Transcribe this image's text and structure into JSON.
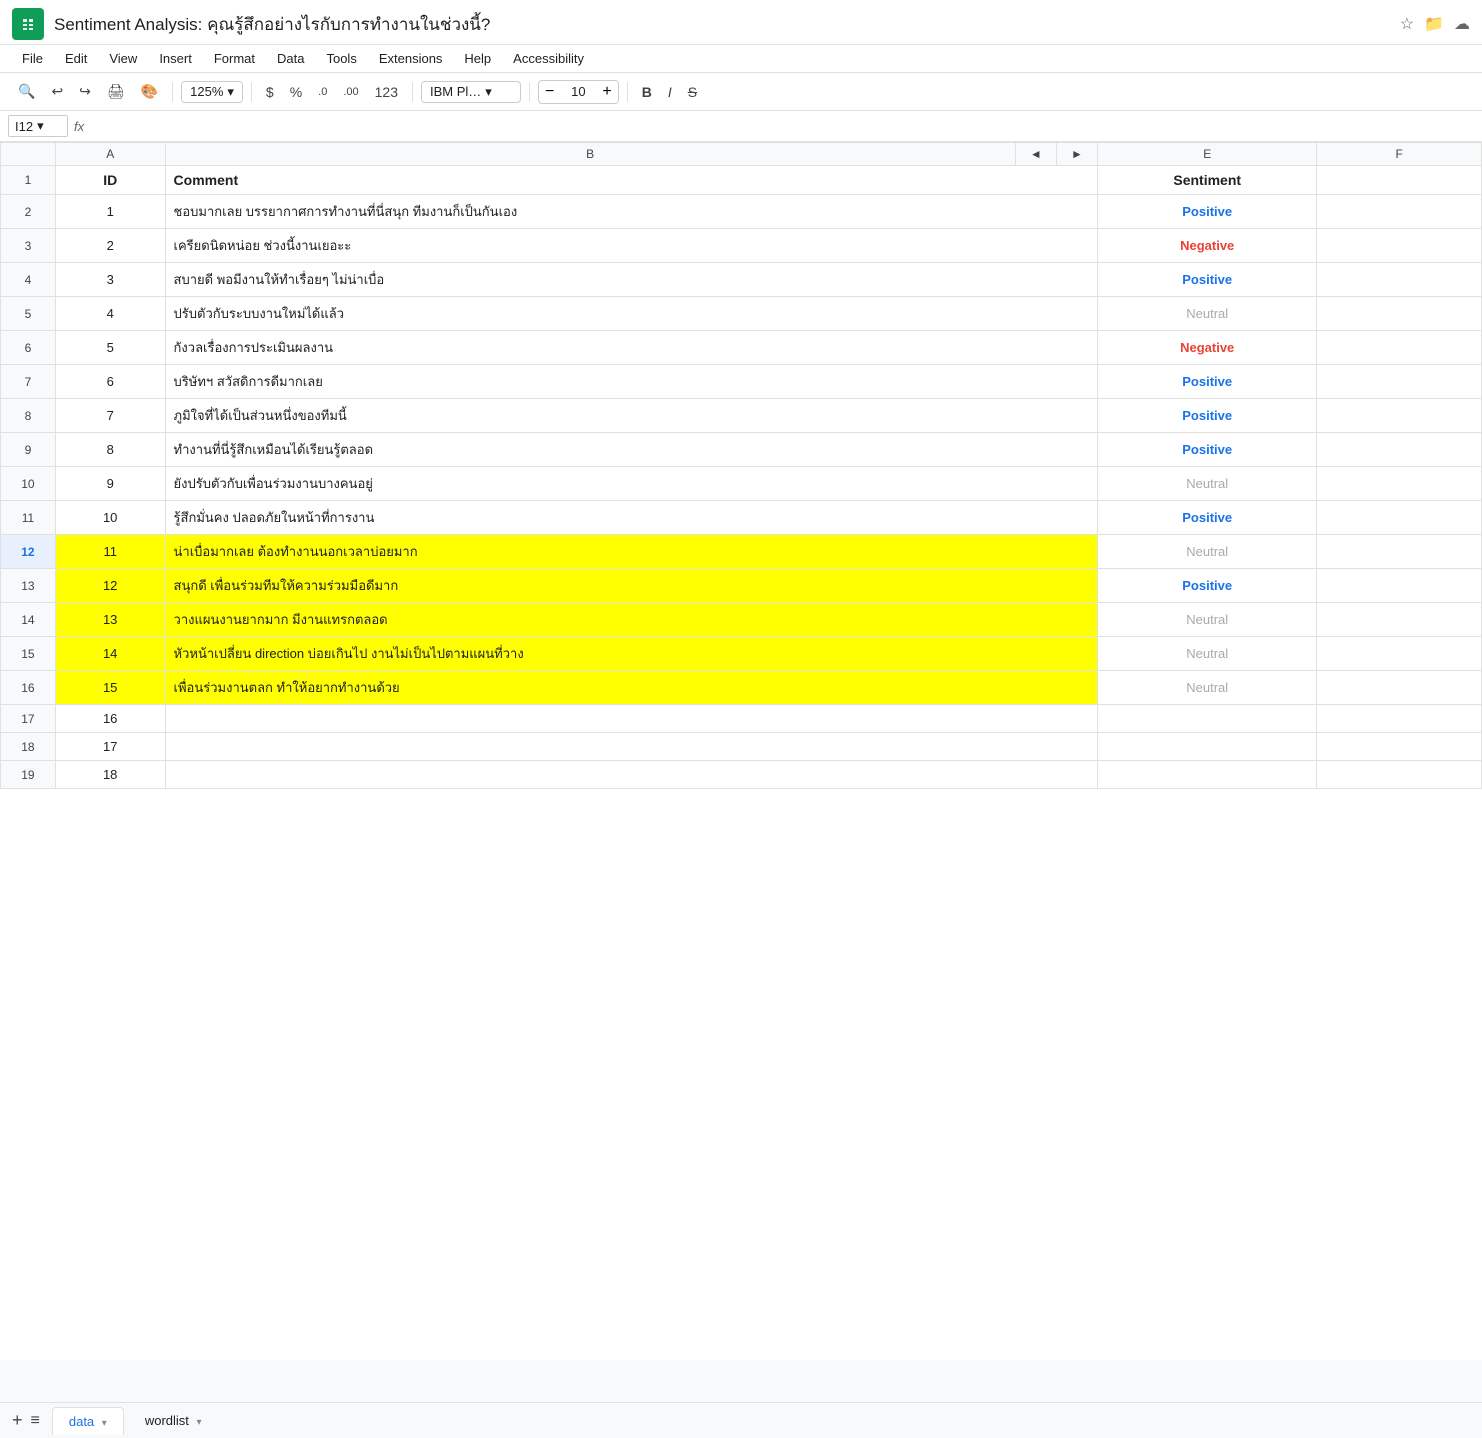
{
  "window": {
    "title": "Sentiment Analysis: คุณรู้สึกอย่างไรกับการทำงานในช่วงนี้?"
  },
  "menu": {
    "items": [
      "File",
      "Edit",
      "View",
      "Insert",
      "Format",
      "Data",
      "Tools",
      "Extensions",
      "Help",
      "Accessibility"
    ]
  },
  "toolbar": {
    "zoom": "125%",
    "font": "IBM Pl…",
    "font_size": "10",
    "currency_symbol": "$",
    "percent_symbol": "%",
    "decimal_decrease": ".0",
    "decimal_increase": ".00",
    "number_format": "123"
  },
  "formula_bar": {
    "cell_ref": "I12",
    "fx_label": "fx"
  },
  "columns": {
    "num": "",
    "a": "A",
    "b": "B",
    "arrow_left": "◄",
    "arrow_right": "►",
    "e": "E",
    "f": "F"
  },
  "rows": [
    {
      "row": "1",
      "id": "ID",
      "comment": "Comment",
      "sentiment": "Sentiment",
      "is_header": true,
      "highlighted": false,
      "active": false
    },
    {
      "row": "2",
      "id": "1",
      "comment": "ชอบมากเลย บรรยากาศการทำงานที่นี่สนุก ทีมงานก็เป็นกันเอง",
      "sentiment": "Positive",
      "sentiment_type": "positive",
      "highlighted": false,
      "active": false
    },
    {
      "row": "3",
      "id": "2",
      "comment": "เครียดนิดหน่อย ช่วงนี้งานเยอะะ",
      "sentiment": "Negative",
      "sentiment_type": "negative",
      "highlighted": false,
      "active": false
    },
    {
      "row": "4",
      "id": "3",
      "comment": "สบายดี พอมีงานให้ทำเรื่อยๆ ไม่น่าเบื่อ",
      "sentiment": "Positive",
      "sentiment_type": "positive",
      "highlighted": false,
      "active": false
    },
    {
      "row": "5",
      "id": "4",
      "comment": "ปรับตัวกับระบบงานใหม่ได้แล้ว",
      "sentiment": "Neutral",
      "sentiment_type": "neutral",
      "highlighted": false,
      "active": false
    },
    {
      "row": "6",
      "id": "5",
      "comment": "กังวลเรื่องการประเมินผลงาน",
      "sentiment": "Negative",
      "sentiment_type": "negative",
      "highlighted": false,
      "active": false
    },
    {
      "row": "7",
      "id": "6",
      "comment": "บริษัทฯ สวัสดิการดีมากเลย",
      "sentiment": "Positive",
      "sentiment_type": "positive",
      "highlighted": false,
      "active": false
    },
    {
      "row": "8",
      "id": "7",
      "comment": "ภูมิใจที่ได้เป็นส่วนหนึ่งของทีมนี้",
      "sentiment": "Positive",
      "sentiment_type": "positive",
      "highlighted": false,
      "active": false
    },
    {
      "row": "9",
      "id": "8",
      "comment": "ทำงานที่นี่รู้สึกเหมือนได้เรียนรู้ตลอด",
      "sentiment": "Positive",
      "sentiment_type": "positive",
      "highlighted": false,
      "active": false
    },
    {
      "row": "10",
      "id": "9",
      "comment": "ยังปรับตัวกับเพื่อนร่วมงานบางคนอยู่",
      "sentiment": "Neutral",
      "sentiment_type": "neutral",
      "highlighted": false,
      "active": false
    },
    {
      "row": "11",
      "id": "10",
      "comment": "รู้สึกมั่นคง ปลอดภัยในหน้าที่การงาน",
      "sentiment": "Positive",
      "sentiment_type": "positive",
      "highlighted": false,
      "active": false
    },
    {
      "row": "12",
      "id": "11",
      "comment": "น่าเบื่อมากเลย ต้องทำงานนอกเวลาบ่อยมาก",
      "sentiment": "Neutral",
      "sentiment_type": "neutral",
      "highlighted": true,
      "active": true
    },
    {
      "row": "13",
      "id": "12",
      "comment": "สนุกดี เพื่อนร่วมทีมให้ความร่วมมือดีมาก",
      "sentiment": "Positive",
      "sentiment_type": "positive",
      "highlighted": true,
      "active": false
    },
    {
      "row": "14",
      "id": "13",
      "comment": "วางแผนงานยากมาก มีงานแทรกตลอด",
      "sentiment": "Neutral",
      "sentiment_type": "neutral",
      "highlighted": true,
      "active": false
    },
    {
      "row": "15",
      "id": "14",
      "comment": "หัวหน้าเปลี่ยน direction บ่อยเกินไป งานไม่เป็นไปตามแผนที่วาง",
      "sentiment": "Neutral",
      "sentiment_type": "neutral",
      "highlighted": true,
      "active": false
    },
    {
      "row": "16",
      "id": "15",
      "comment": "เพื่อนร่วมงานตลก ทำให้อยากทำงานด้วย",
      "sentiment": "Neutral",
      "sentiment_type": "neutral",
      "highlighted": true,
      "active": false
    },
    {
      "row": "17",
      "id": "16",
      "comment": "",
      "sentiment": "",
      "sentiment_type": "none",
      "highlighted": false,
      "active": false
    },
    {
      "row": "18",
      "id": "17",
      "comment": "",
      "sentiment": "",
      "sentiment_type": "none",
      "highlighted": false,
      "active": false
    },
    {
      "row": "19",
      "id": "18",
      "comment": "",
      "sentiment": "",
      "sentiment_type": "none",
      "highlighted": false,
      "active": false
    }
  ],
  "tabs": [
    {
      "label": "data",
      "active": true
    },
    {
      "label": "wordlist",
      "active": false
    }
  ],
  "colors": {
    "positive": "#1a73e8",
    "negative": "#ea4335",
    "neutral": "#aaa",
    "highlight": "#ffff00",
    "active_row_bg": "#e8f0fe"
  }
}
